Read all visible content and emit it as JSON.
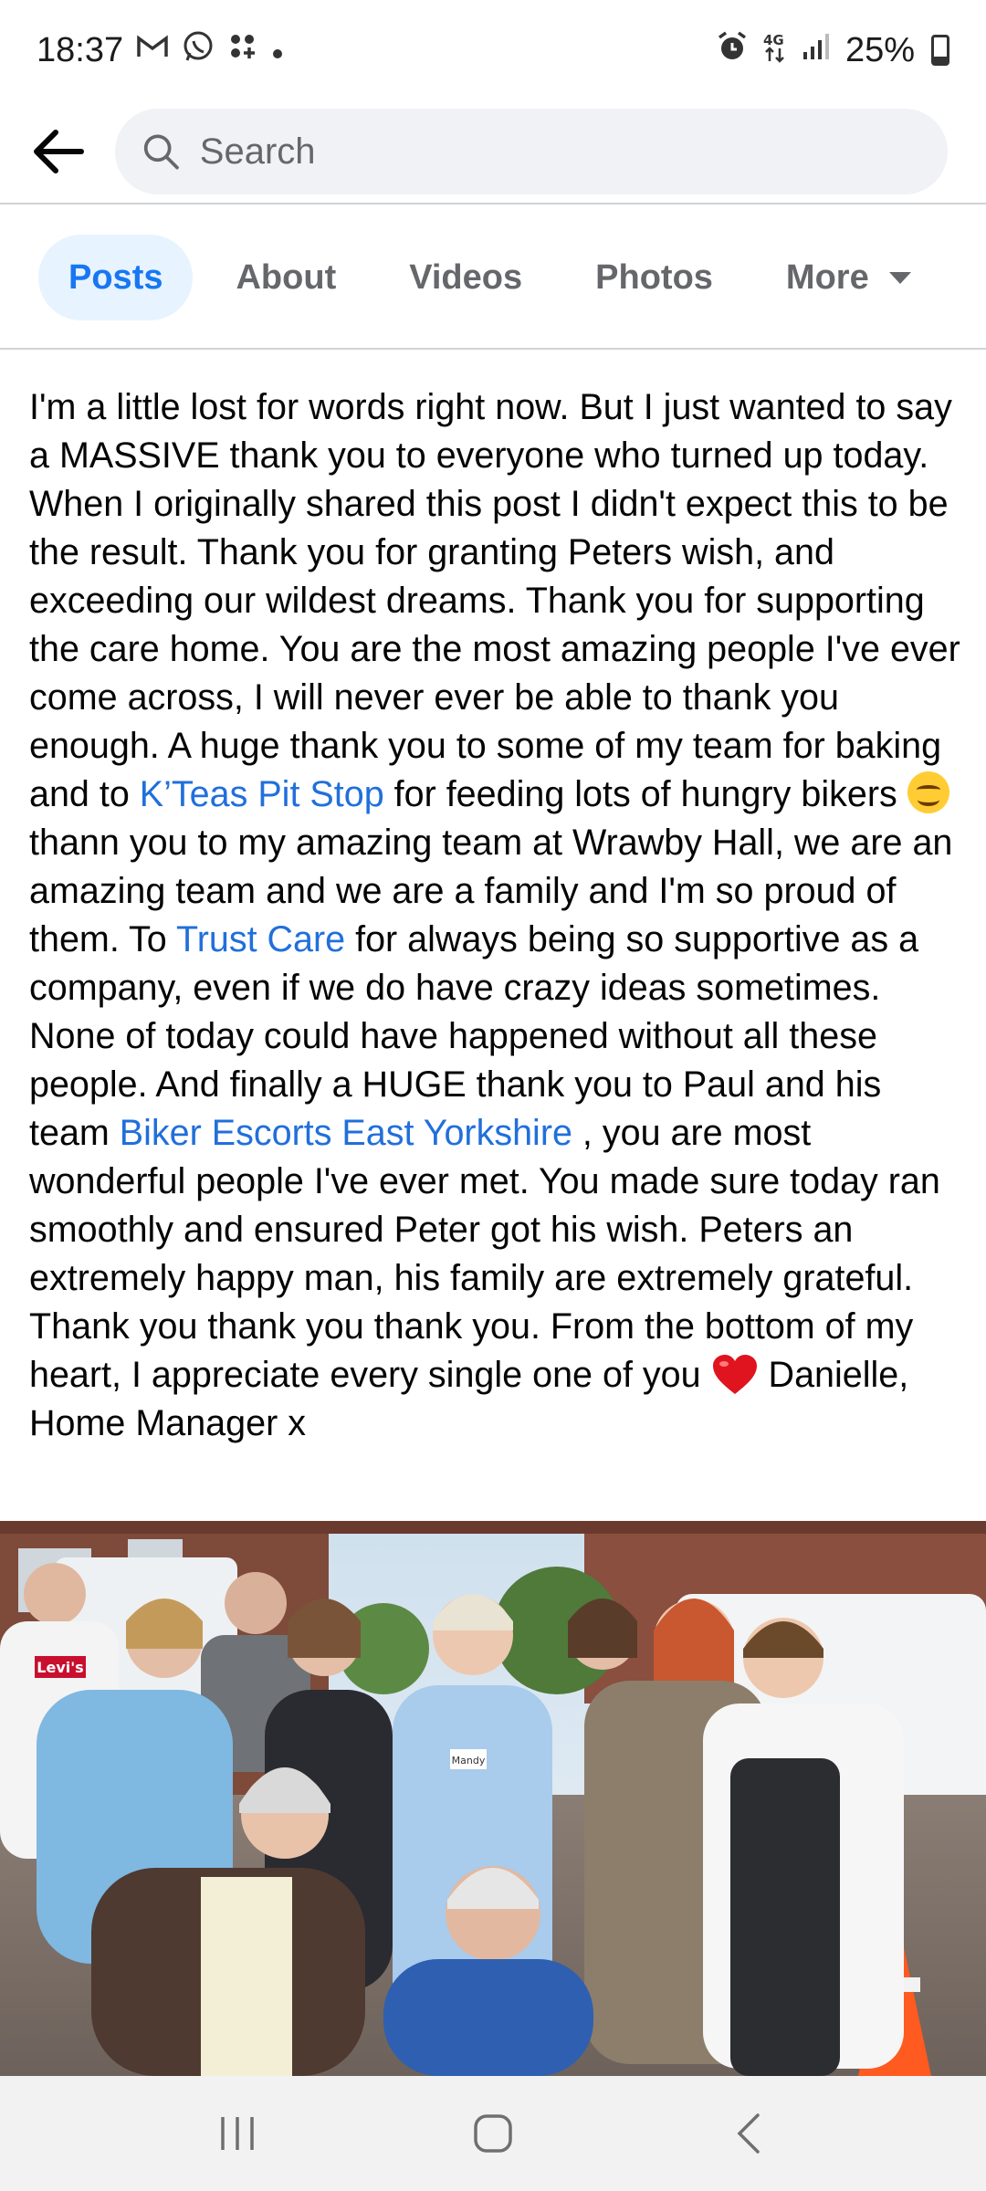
{
  "status_bar": {
    "time": "18:37",
    "left_icons": [
      "gmail-icon",
      "whatsapp-icon",
      "app-dots-icon",
      "dot-icon"
    ],
    "right_icons": [
      "alarm-icon",
      "4g-icon",
      "signal-icon"
    ],
    "battery": "25%"
  },
  "search": {
    "placeholder": "Search"
  },
  "tabs": [
    {
      "label": "Posts",
      "active": true
    },
    {
      "label": "About"
    },
    {
      "label": "Videos"
    },
    {
      "label": "Photos"
    },
    {
      "label": "More"
    }
  ],
  "post": {
    "text_1": "I'm a little lost for words right now. But I just wanted to say a MASSIVE thank you to everyone who turned up today. When I originally shared this post I didn't expect this to be the result. Thank you for granting Peters wish, and exceeding our wildest dreams. Thank you for supporting the care home. You are the most amazing people I've ever come across, I will never ever be able to thank you enough. A huge thank you to some of my team for baking and to ",
    "link_1": "K’Teas Pit Stop",
    "text_2": "  for feeding lots of hungry bikers ",
    "text_3": " thann you to my amazing team at Wrawby Hall, we are an amazing team and we are a family and I'm so proud of them. To ",
    "link_2": "Trust Care",
    "text_4": " for always being so supportive as a company, even if we do have crazy ideas sometimes. None of today could have happened without all these people. And finally a HUGE thank you to Paul and his team ",
    "link_3": "Biker Escorts East Yorkshire",
    "text_5": " , you are most wonderful people I've ever met. You made sure today ran smoothly and ensured Peter got his wish. Peters an extremely happy man, his family are extremely grateful. Thank you thank you thank you. From the bottom of my heart, I appreciate every single one of you ",
    "text_6": " Danielle, Home Manager x"
  },
  "photo": {
    "shirt_text": "Levi's",
    "badge_text": "Mandy"
  },
  "colors": {
    "accent": "#1877f2",
    "link": "#216fdb",
    "tab_active_bg": "#e7f3ff",
    "muted": "#65676b"
  }
}
